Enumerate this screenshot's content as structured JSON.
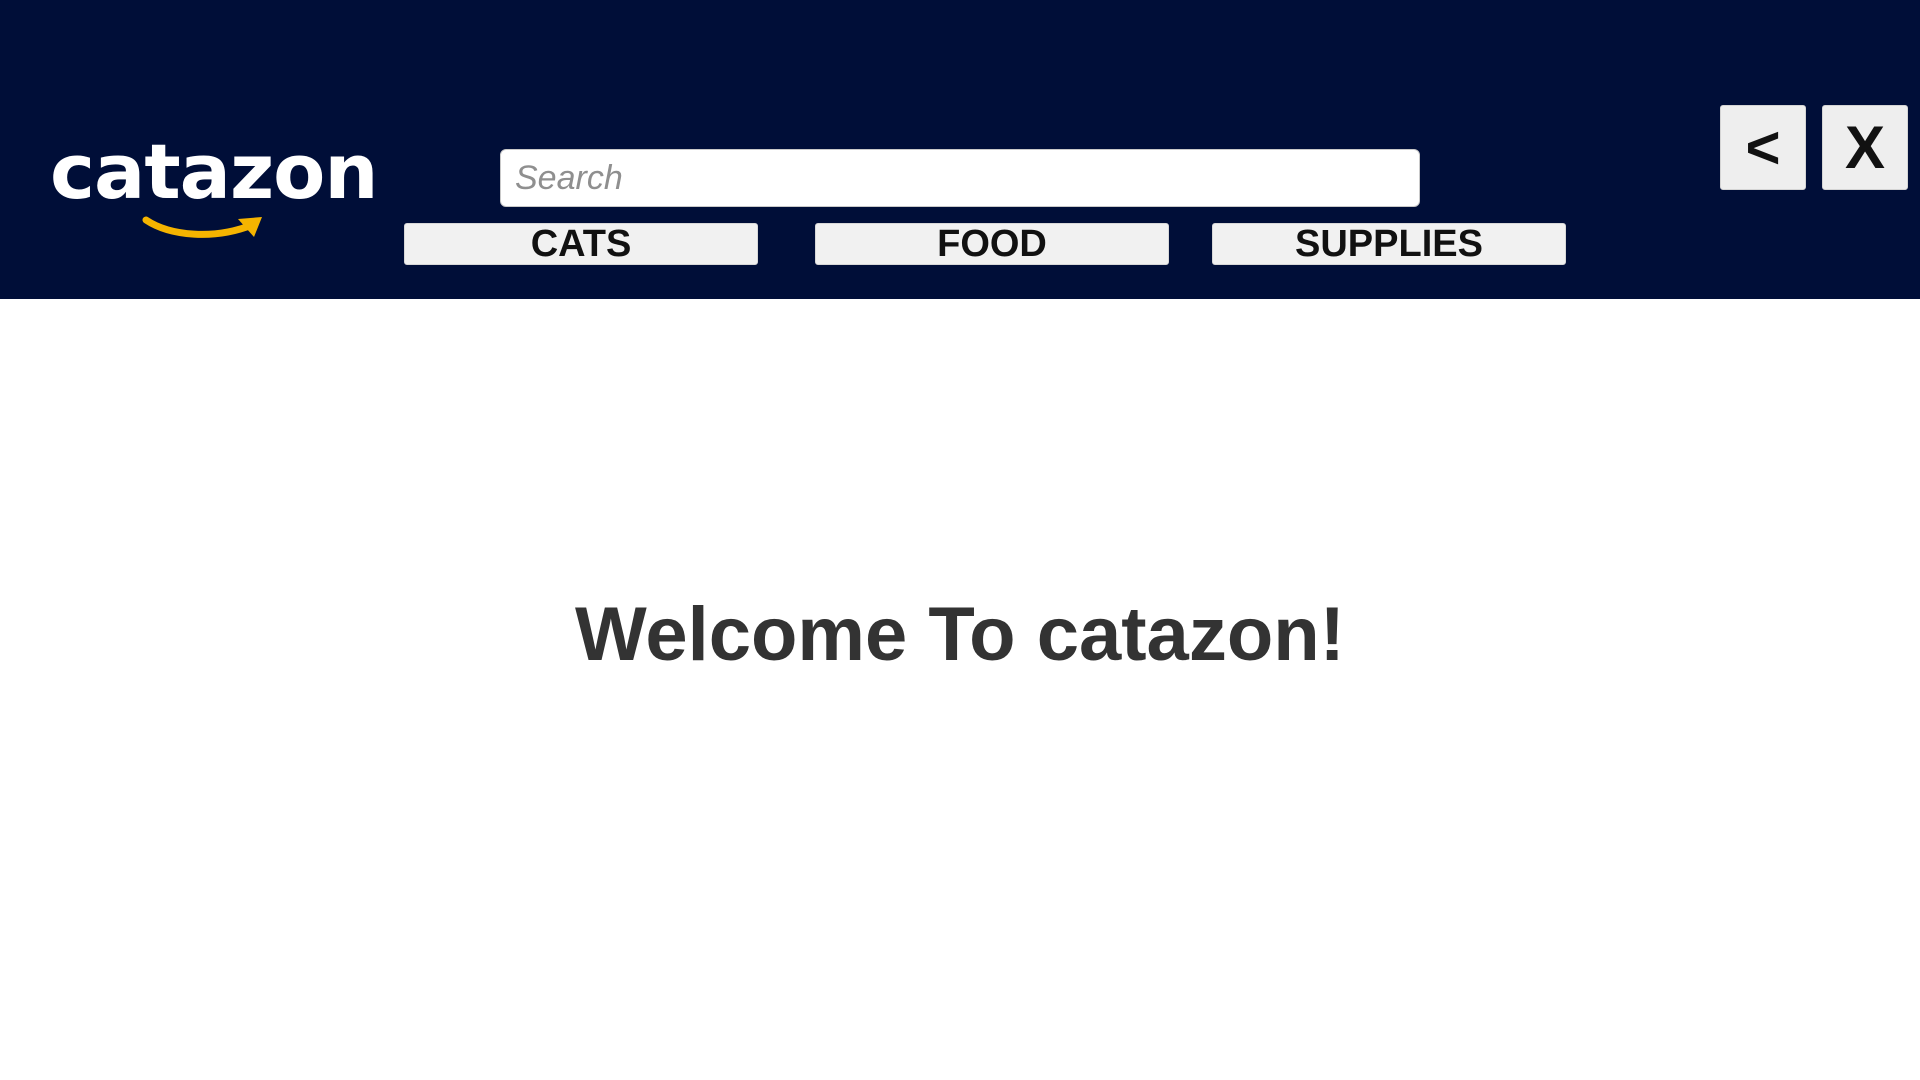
{
  "header": {
    "background_color": "#000e38",
    "logo": {
      "text": "catazon",
      "smile_icon": "smile-arrow-icon",
      "smile_color": "#f5b400"
    },
    "search": {
      "placeholder": "Search",
      "value": ""
    },
    "nav": {
      "cats_label": "CATS",
      "food_label": "FOOD",
      "supplies_label": "SUPPLIES"
    },
    "window_controls": {
      "back_label": "<",
      "close_label": "X"
    }
  },
  "main": {
    "welcome_text": "Welcome To catazon!"
  }
}
